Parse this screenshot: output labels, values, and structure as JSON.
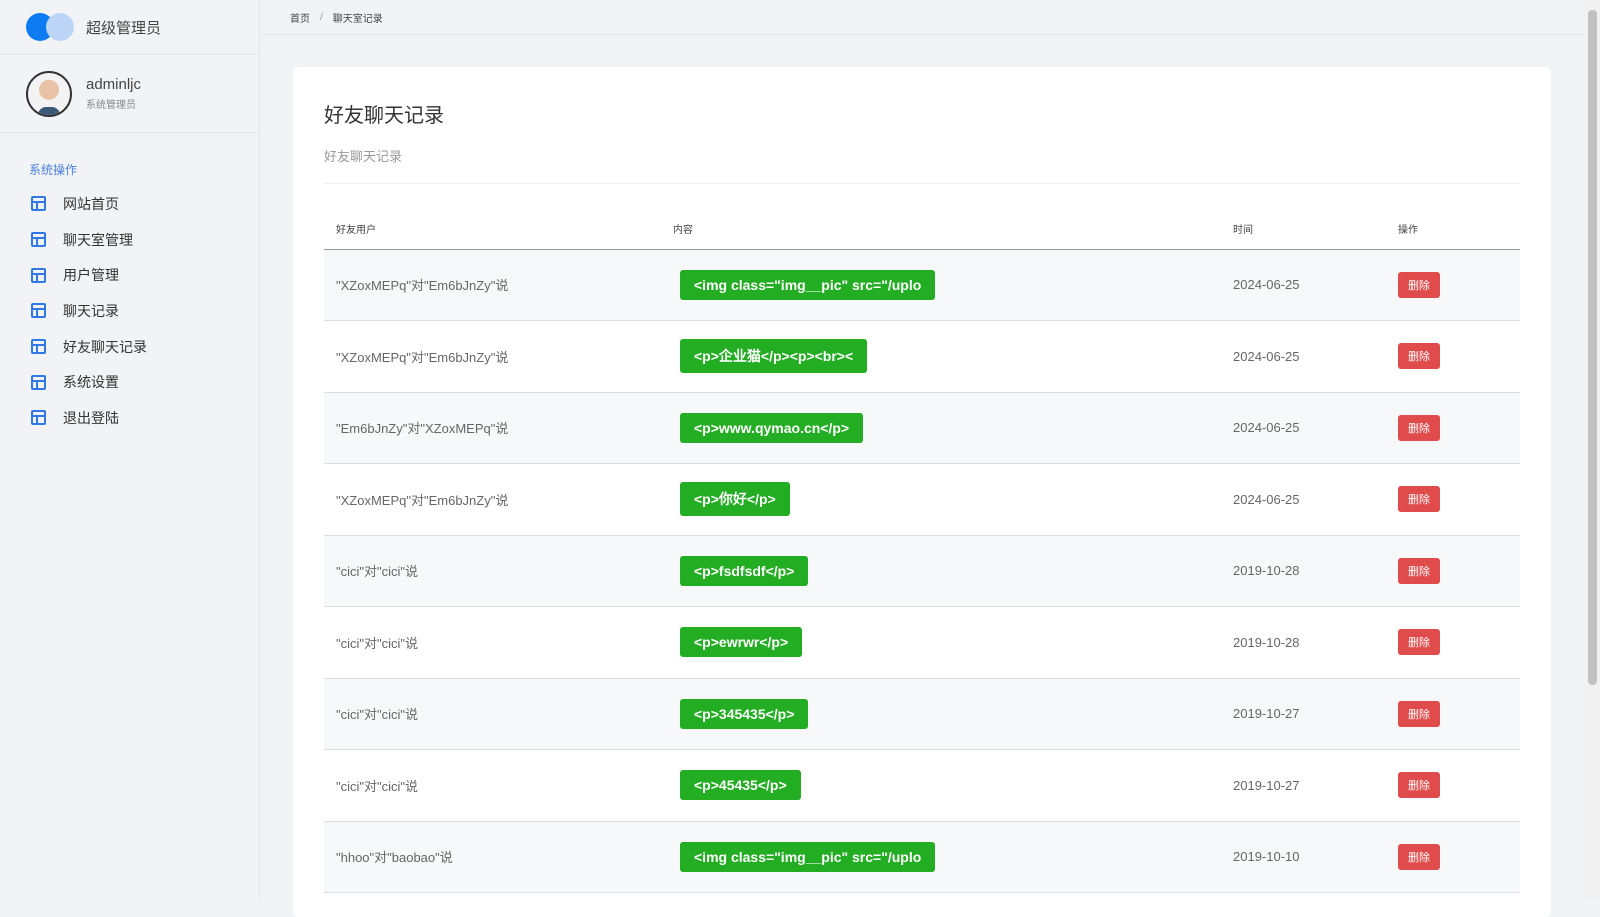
{
  "app": {
    "title": "超级管理员"
  },
  "user": {
    "name": "adminljc",
    "role": "系统管理员"
  },
  "sidebar": {
    "section": "系统操作",
    "items": [
      {
        "label": "网站首页"
      },
      {
        "label": "聊天室管理"
      },
      {
        "label": "用户管理"
      },
      {
        "label": "聊天记录"
      },
      {
        "label": "好友聊天记录"
      },
      {
        "label": "系统设置"
      },
      {
        "label": "退出登陆"
      }
    ]
  },
  "breadcrumb": {
    "home": "首页",
    "sep": "/",
    "current": "聊天室记录"
  },
  "page": {
    "title": "好友聊天记录",
    "subtitle": "好友聊天记录"
  },
  "table": {
    "headers": [
      "好友用户",
      "内容",
      "时间",
      "操作"
    ],
    "rows": [
      {
        "user": "\"XZoxMEPq\"对\"Em6bJnZy\"说",
        "content": "<img class=\"img__pic\" src=\"/uplo",
        "time": "2024-06-25",
        "action": "删除"
      },
      {
        "user": "\"XZoxMEPq\"对\"Em6bJnZy\"说",
        "content": "<p>企业猫</p><p><br><",
        "time": "2024-06-25",
        "action": "删除"
      },
      {
        "user": "\"Em6bJnZy\"对\"XZoxMEPq\"说",
        "content": "<p>www.qymao.cn</p>",
        "time": "2024-06-25",
        "action": "删除"
      },
      {
        "user": "\"XZoxMEPq\"对\"Em6bJnZy\"说",
        "content": "<p>你好</p>",
        "time": "2024-06-25",
        "action": "删除"
      },
      {
        "user": "\"cici\"对\"cici\"说",
        "content": "<p>fsdfsdf</p>",
        "time": "2019-10-28",
        "action": "删除"
      },
      {
        "user": "\"cici\"对\"cici\"说",
        "content": "<p>ewrwr</p>",
        "time": "2019-10-28",
        "action": "删除"
      },
      {
        "user": "\"cici\"对\"cici\"说",
        "content": "<p>345435</p>",
        "time": "2019-10-27",
        "action": "删除"
      },
      {
        "user": "\"cici\"对\"cici\"说",
        "content": "<p>45435</p>",
        "time": "2019-10-27",
        "action": "删除"
      },
      {
        "user": "\"hhoo\"对\"baobao\"说",
        "content": "<img class=\"img__pic\" src=\"/uplo",
        "time": "2019-10-10",
        "action": "删除"
      }
    ]
  }
}
